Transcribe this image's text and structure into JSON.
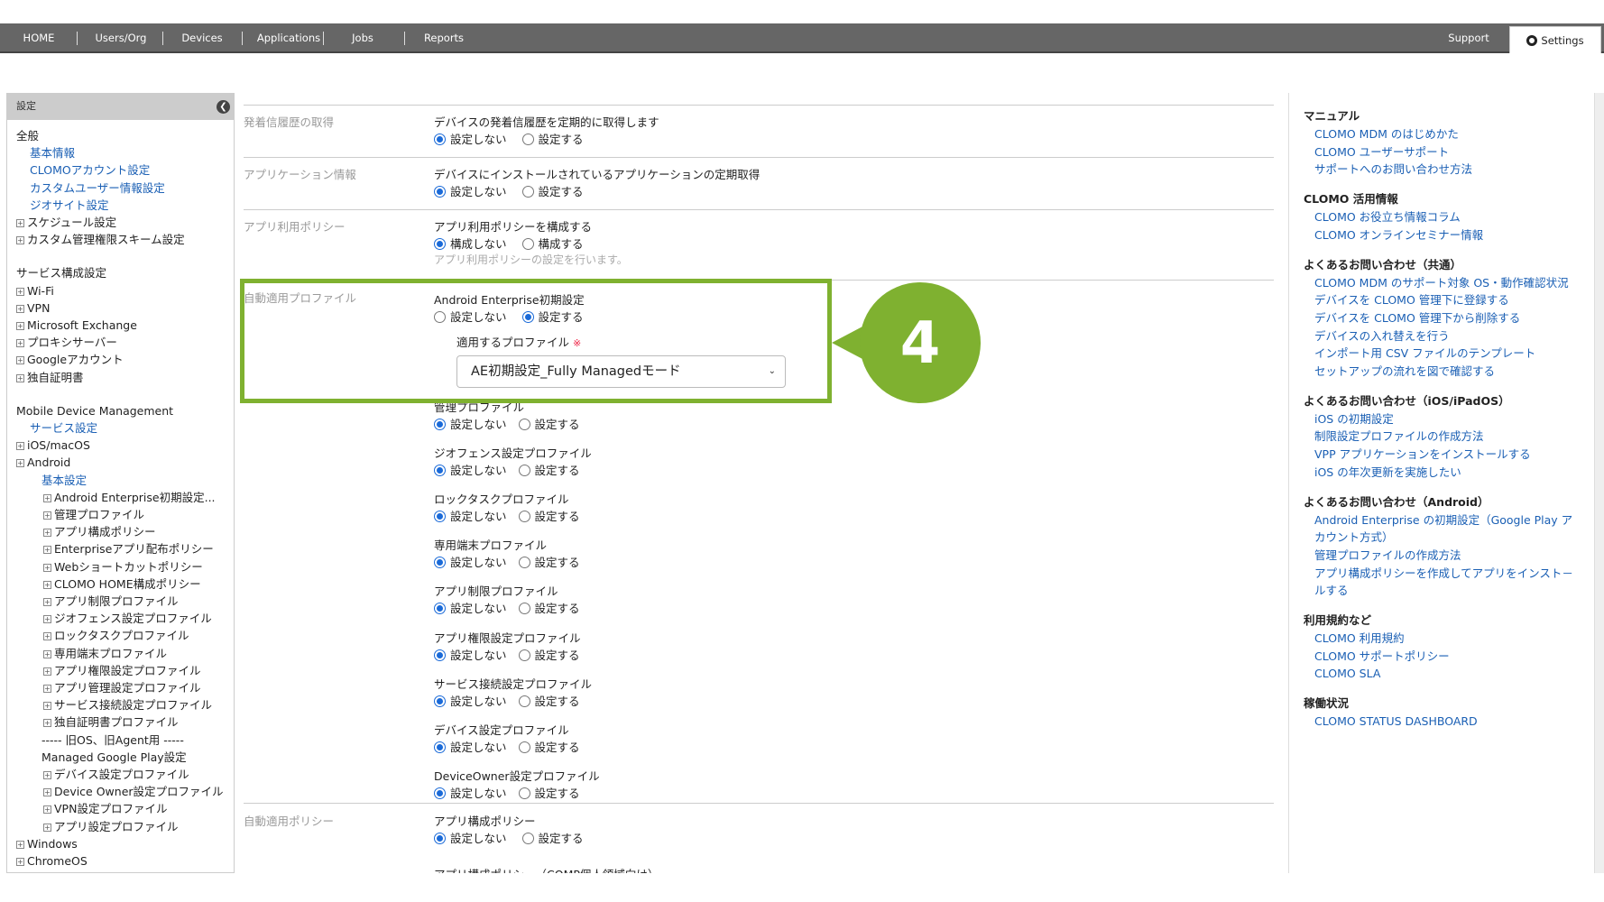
{
  "nav": {
    "items": [
      "HOME",
      "Users/Org",
      "Devices",
      "Applications",
      "Jobs",
      "Reports"
    ],
    "support": "Support",
    "settings": "Settings"
  },
  "sidebar": {
    "header": "設定",
    "lines": [
      {
        "text": "全般",
        "kind": "cat",
        "indent": 0,
        "plus": false
      },
      {
        "text": "基本情報",
        "kind": "link",
        "indent": 1,
        "plus": false
      },
      {
        "text": "CLOMOアカウント設定",
        "kind": "link",
        "indent": 1,
        "plus": false
      },
      {
        "text": "カスタムユーザー情報設定",
        "kind": "link",
        "indent": 1,
        "plus": false
      },
      {
        "text": "ジオサイト設定",
        "kind": "link",
        "indent": 1,
        "plus": false
      },
      {
        "text": "スケジュール設定",
        "kind": "item",
        "indent": 2,
        "plus": true
      },
      {
        "text": "カスタム管理権限スキーム設定",
        "kind": "item",
        "indent": 2,
        "plus": true
      },
      {
        "text": "サービス構成設定",
        "kind": "cat",
        "indent": 0,
        "plus": false
      },
      {
        "text": "Wi-Fi",
        "kind": "item",
        "indent": 2,
        "plus": true
      },
      {
        "text": "VPN",
        "kind": "item",
        "indent": 2,
        "plus": true
      },
      {
        "text": "Microsoft Exchange",
        "kind": "item",
        "indent": 2,
        "plus": true
      },
      {
        "text": "プロキシサーバー",
        "kind": "item",
        "indent": 2,
        "plus": true
      },
      {
        "text": "Googleアカウント",
        "kind": "item",
        "indent": 2,
        "plus": true
      },
      {
        "text": "独自証明書",
        "kind": "item",
        "indent": 2,
        "plus": true
      },
      {
        "text": "Mobile Device Management",
        "kind": "cat",
        "indent": 0,
        "plus": false
      },
      {
        "text": "サービス設定",
        "kind": "link",
        "indent": 1,
        "plus": false
      },
      {
        "text": "iOS/macOS",
        "kind": "item",
        "indent": 2,
        "plus": true
      },
      {
        "text": "Android",
        "kind": "item",
        "indent": 2,
        "plus": true
      },
      {
        "text": "基本設定",
        "kind": "link",
        "indent": 3,
        "plus": false
      },
      {
        "text": "Android Enterprise初期設定...",
        "kind": "item",
        "indent": 4,
        "plus": true
      },
      {
        "text": "管理プロファイル",
        "kind": "item",
        "indent": 4,
        "plus": true
      },
      {
        "text": "アプリ構成ポリシー",
        "kind": "item",
        "indent": 4,
        "plus": true
      },
      {
        "text": "Enterpriseアプリ配布ポリシー",
        "kind": "item",
        "indent": 4,
        "plus": true
      },
      {
        "text": "Webショートカットポリシー",
        "kind": "item",
        "indent": 4,
        "plus": true
      },
      {
        "text": "CLOMO HOME構成ポリシー",
        "kind": "item",
        "indent": 4,
        "plus": true
      },
      {
        "text": "アプリ制限プロファイル",
        "kind": "item",
        "indent": 4,
        "plus": true
      },
      {
        "text": "ジオフェンス設定プロファイル",
        "kind": "item",
        "indent": 4,
        "plus": true
      },
      {
        "text": "ロックタスクプロファイル",
        "kind": "item",
        "indent": 4,
        "plus": true
      },
      {
        "text": "専用端末プロファイル",
        "kind": "item",
        "indent": 4,
        "plus": true
      },
      {
        "text": "アプリ権限設定プロファイル",
        "kind": "item",
        "indent": 4,
        "plus": true
      },
      {
        "text": "アプリ管理設定プロファイル",
        "kind": "item",
        "indent": 4,
        "plus": true
      },
      {
        "text": "サービス接続設定プロファイル",
        "kind": "item",
        "indent": 4,
        "plus": true
      },
      {
        "text": "独自証明書プロファイル",
        "kind": "item",
        "indent": 4,
        "plus": true
      },
      {
        "text": "----- 旧OS、旧Agent用 -----",
        "kind": "item",
        "indent": 3,
        "plus": false
      },
      {
        "text": "Managed Google Play設定",
        "kind": "item",
        "indent": 3,
        "plus": false
      },
      {
        "text": "デバイス設定プロファイル",
        "kind": "item",
        "indent": 4,
        "plus": true
      },
      {
        "text": "Device Owner設定プロファイル",
        "kind": "item",
        "indent": 4,
        "plus": true
      },
      {
        "text": "VPN設定プロファイル",
        "kind": "item",
        "indent": 4,
        "plus": true
      },
      {
        "text": "アプリ設定プロファイル",
        "kind": "item",
        "indent": 4,
        "plus": true
      },
      {
        "text": "Windows",
        "kind": "item",
        "indent": 2,
        "plus": true
      },
      {
        "text": "ChromeOS",
        "kind": "item",
        "indent": 2,
        "plus": true
      }
    ]
  },
  "main": {
    "sections": [
      {
        "label": "発着信履歴の取得",
        "title": "デバイスの発着信履歴を定期的に取得します",
        "opt1": "設定しない",
        "opt2": "設定する",
        "selected": 1
      },
      {
        "label": "アプリケーション情報",
        "title": "デバイスにインストールされているアプリケーションの定期取得",
        "opt1": "設定しない",
        "opt2": "設定する",
        "selected": 1
      },
      {
        "label": "アプリ利用ポリシー",
        "title": "アプリ利用ポリシーを構成する",
        "opt1": "構成しない",
        "opt2": "構成する",
        "selected": 1,
        "note": "アプリ利用ポリシーの設定を行います。"
      }
    ],
    "auto_profile": {
      "label": "自動適用プロファイル",
      "ae_title": "Android Enterprise初期設定",
      "ae_opt1": "設定しない",
      "ae_opt2": "設定する",
      "ae_selected": 2,
      "apply_label": "適用するプロファイル",
      "required_mark": "※",
      "select_value": "AE初期設定_Fully Managedモード",
      "profiles": [
        {
          "title": "管理プロファイル",
          "selected": 1
        },
        {
          "title": "ジオフェンス設定プロファイル",
          "selected": 1
        },
        {
          "title": "ロックタスクプロファイル",
          "selected": 1
        },
        {
          "title": "専用端末プロファイル",
          "selected": 1
        },
        {
          "title": "アプリ制限プロファイル",
          "selected": 1
        },
        {
          "title": "アプリ権限設定プロファイル",
          "selected": 1
        },
        {
          "title": "サービス接続設定プロファイル",
          "selected": 1
        },
        {
          "title": "デバイス設定プロファイル",
          "selected": 1
        },
        {
          "title": "DeviceOwner設定プロファイル",
          "selected": 1
        }
      ],
      "opt1": "設定しない",
      "opt2": "設定する"
    },
    "auto_policy": {
      "label": "自動適用ポリシー",
      "title": "アプリ構成ポリシー",
      "opt1": "設定しない",
      "opt2": "設定する",
      "selected": 1,
      "cut_title": "アプリ構成ポリシー（COMP個人領域向け）"
    }
  },
  "callout": {
    "number": "4",
    "color": "#7fb130"
  },
  "right": {
    "groups": [
      {
        "head": "マニュアル",
        "links": [
          "CLOMO MDM のはじめかた",
          "CLOMO ユーザーサポート",
          "サポートへのお問い合わせ方法"
        ]
      },
      {
        "head": "CLOMO 活用情報",
        "links": [
          "CLOMO お役立ち情報コラム",
          "CLOMO オンラインセミナー情報"
        ]
      },
      {
        "head": "よくあるお問い合わせ（共通）",
        "links": [
          "CLOMO MDM のサポート対象 OS・動作確認状況",
          "デバイスを CLOMO 管理下に登録する",
          "デバイスを CLOMO 管理下から削除する",
          "デバイスの入れ替えを行う",
          "インポート用 CSV ファイルのテンプレート",
          "セットアップの流れを図で確認する"
        ]
      },
      {
        "head": "よくあるお問い合わせ（iOS/iPadOS）",
        "links": [
          "iOS の初期設定",
          "制限設定プロファイルの作成方法",
          "VPP アプリケーションをインストールする",
          "iOS の年次更新を実施したい"
        ]
      },
      {
        "head": "よくあるお問い合わせ（Android）",
        "links": [
          "Android Enterprise の初期設定（Google Play ア",
          "カウント方式）",
          "管理プロファイルの作成方法",
          "アプリ構成ポリシーを作成してアプリをインスト－",
          "ルする"
        ]
      },
      {
        "head": "利用規約など",
        "links": [
          "CLOMO 利用規約",
          "CLOMO サポートポリシー",
          "CLOMO SLA"
        ]
      },
      {
        "head": "稼働状況",
        "links": [
          "CLOMO STATUS DASHBOARD"
        ]
      }
    ]
  }
}
